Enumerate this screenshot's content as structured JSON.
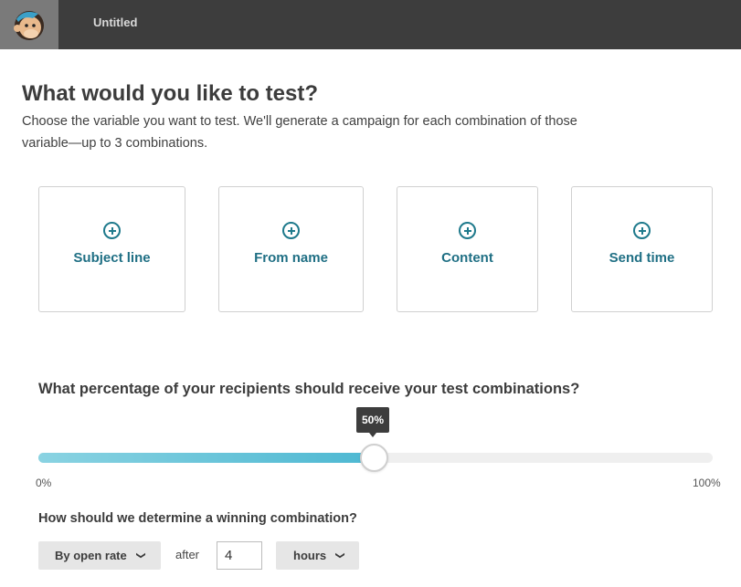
{
  "header": {
    "title": "Untitled",
    "logo_icon": "mailchimp-monkey-logo"
  },
  "main": {
    "heading": "What would you like to test?",
    "description": "Choose the variable you want to test. We'll generate a campaign for each combination of those variable—up to 3 combinations.",
    "variables": [
      {
        "label": "Subject line",
        "icon": "add-circle-icon"
      },
      {
        "label": "From name",
        "icon": "add-circle-icon"
      },
      {
        "label": "Content",
        "icon": "add-circle-icon"
      },
      {
        "label": "Send time",
        "icon": "add-circle-icon"
      }
    ]
  },
  "percentage": {
    "question": "What percentage of your recipients should receive your test combinations?",
    "value": 50,
    "tooltip": "50%",
    "min_label": "0%",
    "max_label": "100%"
  },
  "winner": {
    "question": "How should we determine a winning combination?",
    "metric_select": "By open rate",
    "after_label": "after",
    "duration_value": "4",
    "unit_select": "hours"
  },
  "colors": {
    "accent": "#1f6f84",
    "slider_fill": "#4db8d2",
    "topbar": "#3d3d3d"
  }
}
